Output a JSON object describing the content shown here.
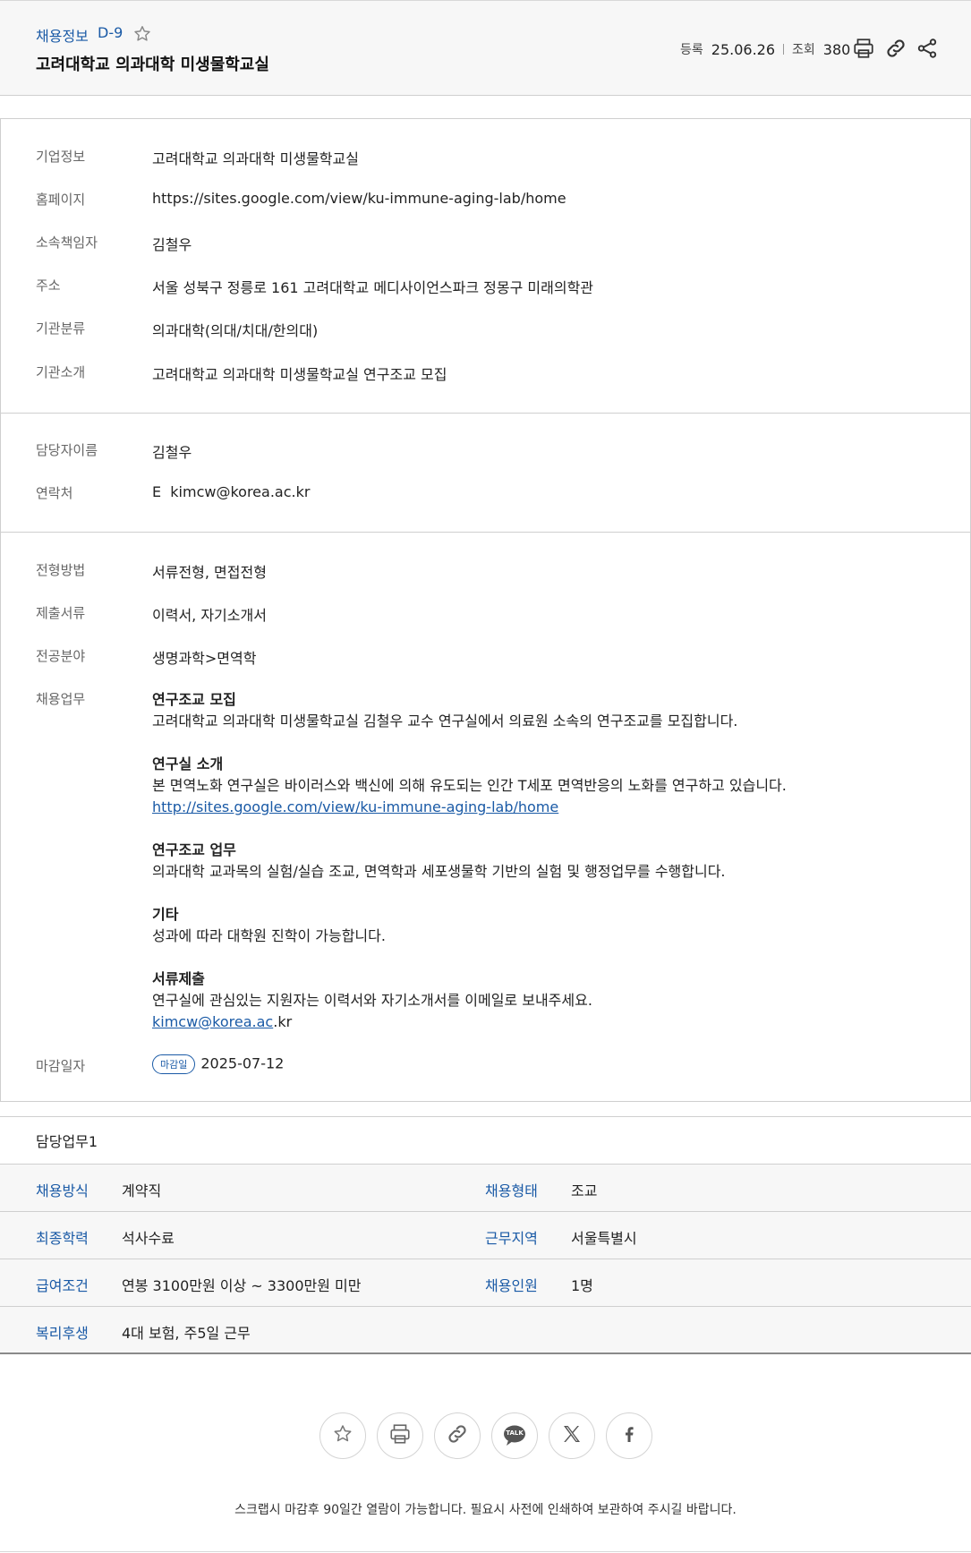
{
  "header": {
    "category": "채용정보",
    "dday": "D-9",
    "title": "고려대학교 의과대학 미생물학교실",
    "reg_label": "등록",
    "reg_date": "25.06.26",
    "view_label": "조회",
    "view_count": "380"
  },
  "company": {
    "rows": [
      {
        "label": "기업정보",
        "value": "고려대학교 의과대학 미생물학교실"
      },
      {
        "label": "홈페이지",
        "value": "https://sites.google.com/view/ku-immune-aging-lab/home"
      },
      {
        "label": "소속책임자",
        "value": "김철우"
      },
      {
        "label": "주소",
        "value": "서울 성북구 정릉로 161 고려대학교 메디사이언스파크 정몽구 미래의학관"
      },
      {
        "label": "기관분류",
        "value": "의과대학(의대/치대/한의대)"
      },
      {
        "label": "기관소개",
        "value": "고려대학교 의과대학 미생물학교실 연구조교 모집"
      }
    ]
  },
  "contact": {
    "name_label": "담당자이름",
    "name": "김철우",
    "phone_label": "연락처",
    "email_prefix": "E",
    "email": "kimcw@korea.ac.kr"
  },
  "recruit": {
    "method_label": "전형방법",
    "method": "서류전형, 면접전형",
    "docs_label": "제출서류",
    "docs": "이력서, 자기소개서",
    "field_label": "전공분야",
    "field": "생명과학>면역학",
    "duty_label": "채용업무",
    "duty": {
      "h1": "연구조교 모집",
      "p1": "고려대학교 의과대학 미생물학교실 김철우 교수 연구실에서 의료원 소속의 연구조교를 모집합니다.",
      "h2": "연구실 소개",
      "p2": "본 면역노화 연구실은 바이러스와 백신에 의해 유도되는 인간 T세포 면역반응의 노화를 연구하고 있습니다.",
      "link": "http://sites.google.com/view/ku-immune-aging-lab/home",
      "h3": "연구조교 업무",
      "p3": "의과대학 교과목의 실험/실습 조교, 면역학과 세포생물학 기반의 실험 및 행정업무를 수행합니다.",
      "h4": "기타",
      "p4": "성과에 따라 대학원 진학이 가능합니다.",
      "h5": "서류제출",
      "p5": "연구실에 관심있는 지원자는 이력서와 자기소개서를 이메일로 보내주세요.",
      "email_link": "kimcw@korea.ac",
      "email_tail": ".kr"
    },
    "deadline_label": "마감일자",
    "deadline_badge": "마감일",
    "deadline": "2025-07-12"
  },
  "duty_block": {
    "title": "담당업무1",
    "rows": [
      {
        "k1": "채용방식",
        "v1": "계약직",
        "k2": "채용형태",
        "v2": "조교"
      },
      {
        "k1": "최종학력",
        "v1": "석사수료",
        "k2": "근무지역",
        "v2": "서울특별시"
      },
      {
        "k1": "급여조건",
        "v1": "연봉 3100만원 이상 ~ 3300만원 미만",
        "k2": "채용인원",
        "v2": "1명"
      },
      {
        "k1": "복리후생",
        "v1": "4대 보험, 주5일 근무",
        "k2": "",
        "v2": ""
      }
    ]
  },
  "share_icons": [
    "star-icon",
    "print-icon",
    "link-icon",
    "kakaotalk-icon",
    "x-icon",
    "facebook-icon"
  ],
  "kakao_label": "TALK",
  "footnote": "스크랩시 마감후 90일간 열람이 가능합니다. 필요시 사전에 인쇄하여 보관하여 주시길 바랍니다.",
  "colors": {
    "accent": "#1a5aa6",
    "header_bg": "#f7f7f7",
    "border": "#cfcfcf"
  }
}
